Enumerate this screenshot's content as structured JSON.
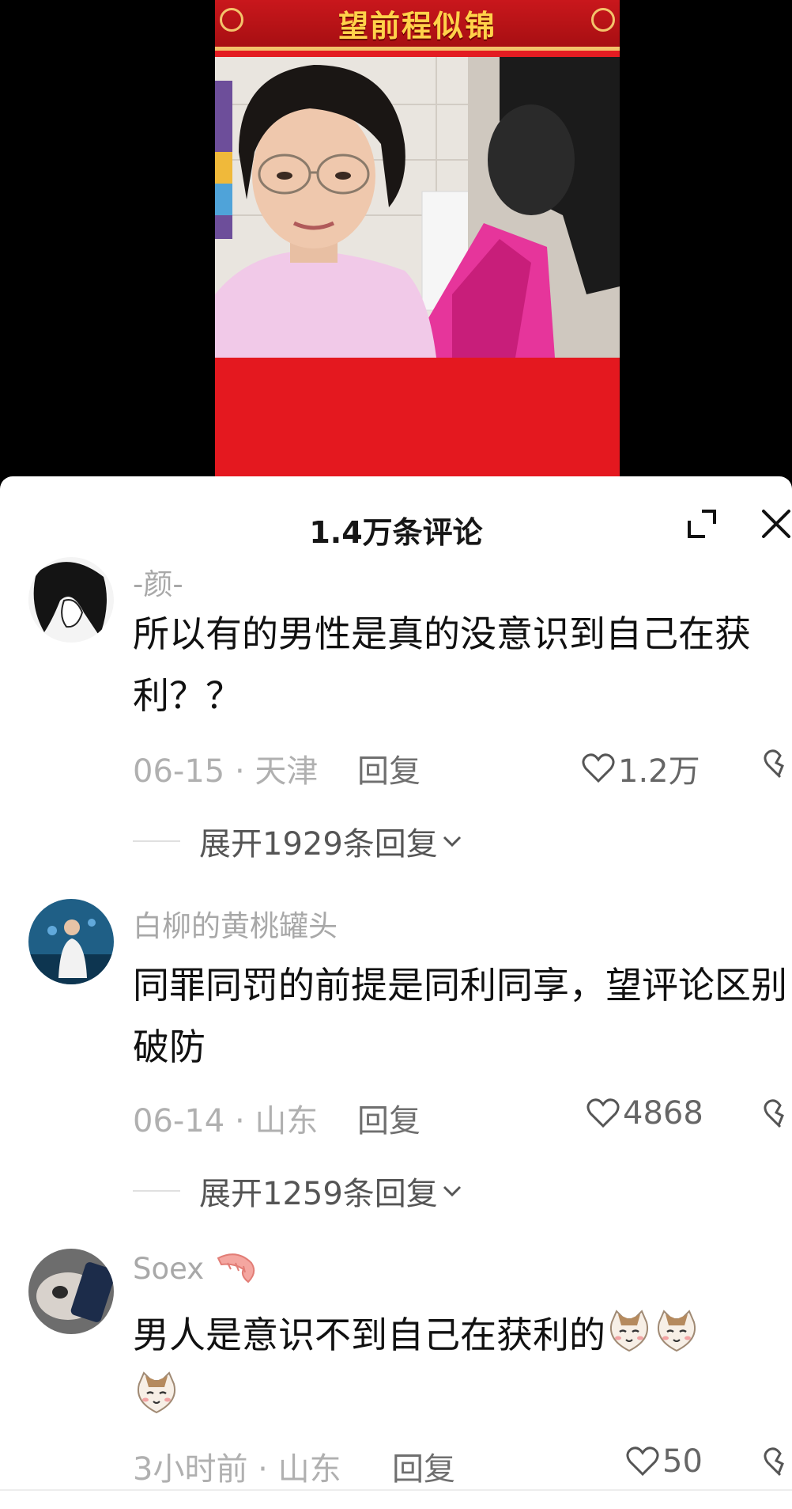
{
  "video": {
    "banner_title": "望前程似锦"
  },
  "sheet": {
    "title": "1.4万条评论",
    "expand_icon": "expand-corner-icon",
    "close_icon": "close-icon"
  },
  "comments": [
    {
      "username": "-颜-",
      "text": "所以有的男性是真的没意识到自己在获利？？",
      "date_location": "06-15 · 天津",
      "reply_label": "回复",
      "likes": "1.2万",
      "expand_replies": "展开1929条回复"
    },
    {
      "username": "白柳的黄桃罐头",
      "text": "同罪同罚的前提是同利同享，望评论区别破防",
      "date_location": "06-14 · 山东",
      "reply_label": "回复",
      "likes": "4868",
      "expand_replies": "展开1259条回复"
    },
    {
      "username": "Soex",
      "username_badge": "shrimp-icon",
      "text": "男人是意识不到自己在获利的",
      "emoji": [
        "cat-face-emoji",
        "cat-face-emoji",
        "cat-face-emoji"
      ],
      "date_location": "3小时前 · 山东",
      "reply_label": "回复",
      "likes": "50"
    }
  ],
  "colors": {
    "banner_red": "#c9171c",
    "banner_gold": "#ffd24a",
    "video_red": "#e4181f",
    "text_main": "#111111",
    "text_muted": "#a8a8a8"
  }
}
